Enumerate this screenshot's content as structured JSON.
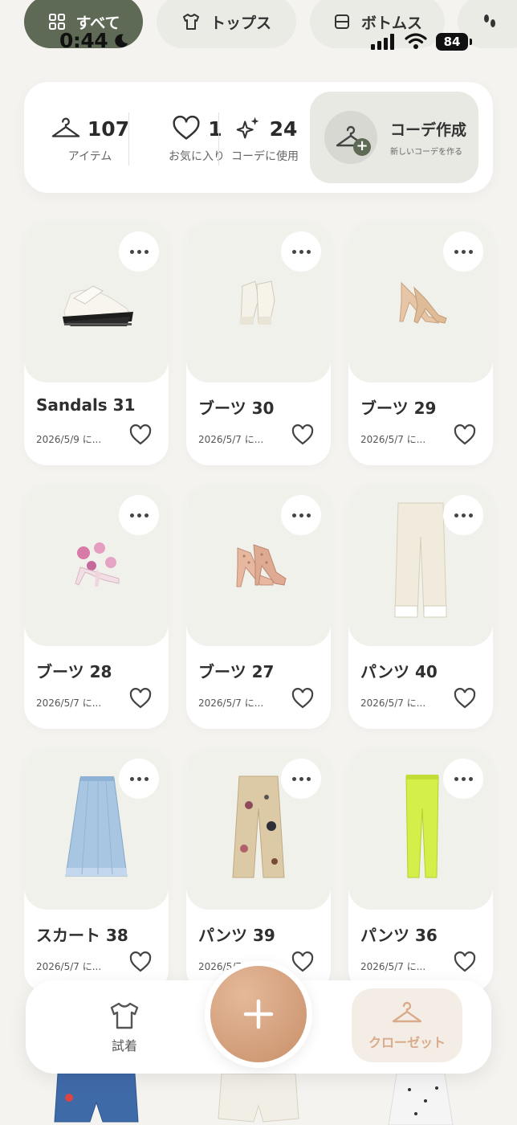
{
  "status": {
    "time": "0:44",
    "battery": "84"
  },
  "categories": [
    {
      "label": "すべて",
      "icon": "grid-icon",
      "active": true
    },
    {
      "label": "トップス",
      "icon": "tshirt-icon",
      "active": false
    },
    {
      "label": "ボトムス",
      "icon": "bottoms-icon",
      "active": false
    },
    {
      "label": "",
      "icon": "shoes-icon",
      "active": false
    }
  ],
  "stats": {
    "items": {
      "value": "107",
      "label": "アイテム",
      "icon": "hanger-icon"
    },
    "favorites": {
      "value": "1",
      "label": "お気に入り",
      "icon": "heart-icon"
    },
    "used": {
      "value": "24",
      "label": "コーデに使用",
      "icon": "sparkle-icon"
    }
  },
  "create_coord": {
    "title": "コーデ作成",
    "subtitle": "新しいコーデを作る"
  },
  "items": [
    {
      "name": "Sandals 31",
      "date": "2026/5/9 に...",
      "kind": "sandal-platform"
    },
    {
      "name": "ブーツ 30",
      "date": "2026/5/7 に...",
      "kind": "sandal-white"
    },
    {
      "name": "ブーツ 29",
      "date": "2026/5/7 に...",
      "kind": "heel-nude"
    },
    {
      "name": "ブーツ 28",
      "date": "2026/5/7 に...",
      "kind": "heel-floral"
    },
    {
      "name": "ブーツ 27",
      "date": "2026/5/7 に...",
      "kind": "heel-studded"
    },
    {
      "name": "パンツ 40",
      "date": "2026/5/7 に...",
      "kind": "pants-cream"
    },
    {
      "name": "スカート 38",
      "date": "2026/5/7 に...",
      "kind": "skirt-blue"
    },
    {
      "name": "パンツ 39",
      "date": "2026/5/7 に...",
      "kind": "pants-embroidered"
    },
    {
      "name": "パンツ 36",
      "date": "2026/5/7 に...",
      "kind": "pants-lime"
    }
  ],
  "bottom_nav": {
    "try_on": "試着",
    "closet": "クローゼット"
  },
  "colors": {
    "accent": "#5e6a55",
    "fab": "#cf9a75",
    "closet_active": "#d9ab8a"
  }
}
